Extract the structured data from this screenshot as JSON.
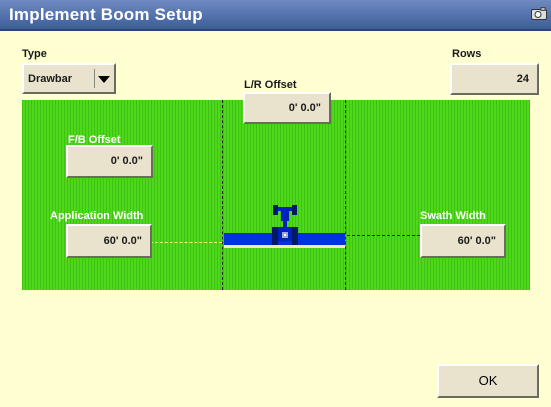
{
  "window": {
    "title": "Implement Boom Setup",
    "camera_icon": "camera-icon"
  },
  "type": {
    "label": "Type",
    "selected": "Drawbar"
  },
  "rows": {
    "label": "Rows",
    "value": "24"
  },
  "lr_offset": {
    "label": "L/R Offset",
    "value": "0' 0.0\""
  },
  "fb_offset": {
    "label": "F/B Offset",
    "value": "0' 0.0\""
  },
  "application_width": {
    "label": "Application Width",
    "value": "60' 0.0\""
  },
  "swath_width": {
    "label": "Swath Width",
    "value": "60' 0.0\""
  },
  "ok_label": "OK",
  "colors": {
    "title_bar": "#4E6CA8",
    "background": "#FFFFD2",
    "field_green": "#4ED81A",
    "boom_blue": "#0033DD"
  }
}
